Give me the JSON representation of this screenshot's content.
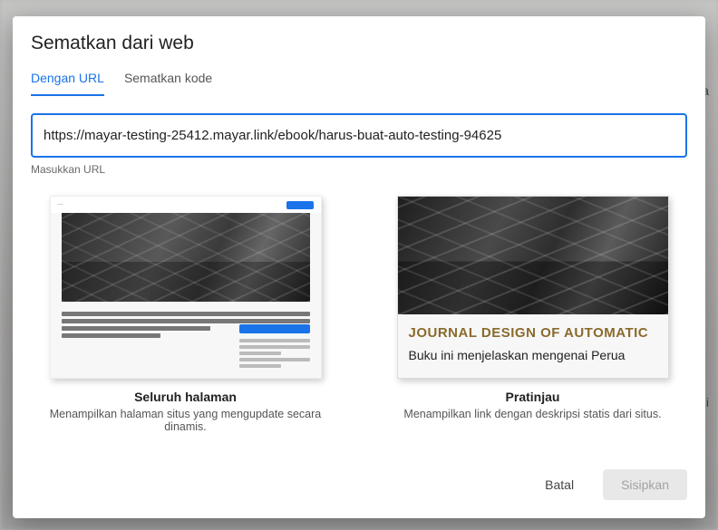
{
  "modal": {
    "title": "Sematkan dari web",
    "tabs": {
      "url": "Dengan URL",
      "code": "Sematkan kode"
    },
    "url_value": "https://mayar-testing-25412.mayar.link/ebook/harus-buat-auto-testing-94625",
    "url_hint": "Masukkan URL",
    "options": {
      "whole_page": {
        "title": "Seluruh halaman",
        "desc": "Menampilkan halaman situs yang mengupdate secara dinamis."
      },
      "preview": {
        "title": "Pratinjau",
        "desc": "Menampilkan link dengan deskripsi statis dari situs.",
        "card_title": "JOURNAL DESIGN OF AUTOMATIC",
        "card_desc": "Buku ini menjelaskan mengenai Perua"
      }
    },
    "buttons": {
      "cancel": "Batal",
      "insert": "Sisipkan"
    }
  }
}
